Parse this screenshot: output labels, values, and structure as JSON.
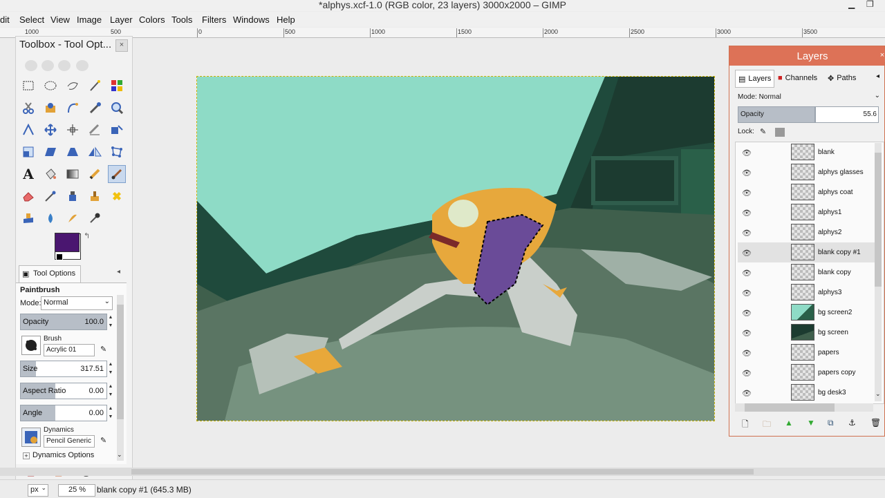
{
  "window": {
    "title": "*alphys.xcf-1.0 (RGB color, 23 layers) 3000x2000 – GIMP"
  },
  "menu": [
    "dit",
    "Select",
    "View",
    "Image",
    "Layer",
    "Colors",
    "Tools",
    "Filters",
    "Windows",
    "Help"
  ],
  "ruler": {
    "labels": [
      "1000",
      "500",
      "0",
      "500",
      "1000",
      "1500",
      "2000",
      "2500",
      "3000",
      "3500"
    ]
  },
  "toolbox": {
    "title": "Toolbox - Tool Opt...",
    "colors": {
      "foreground": "#4a1670",
      "background": "#ffffff"
    },
    "tools": [
      [
        "rect-select-icon",
        "ellipse-select-icon",
        "free-select-icon",
        "fuzzy-select-icon",
        "select-by-color-icon"
      ],
      [
        "scissors-icon",
        "foreground-select-icon",
        "paths-icon",
        "color-picker-icon",
        "zoom-icon"
      ],
      [
        "measure-icon",
        "move-icon",
        "align-icon",
        "crop-icon",
        "rotate-icon"
      ],
      [
        "scale-icon",
        "shear-icon",
        "perspective-icon",
        "flip-icon",
        "cage-icon"
      ],
      [
        "text-icon",
        "bucket-fill-icon",
        "blend-icon",
        "pencil-icon",
        "paintbrush-icon"
      ],
      [
        "eraser-icon",
        "airbrush-icon",
        "ink-icon",
        "clone-icon",
        "heal-icon"
      ],
      [
        "perspective-clone-icon",
        "blur-icon",
        "smudge-icon",
        "dodge-burn-icon"
      ]
    ],
    "active_tool": "paintbrush-icon"
  },
  "tool_options": {
    "tab_label": "Tool Options",
    "tool_name": "Paintbrush",
    "mode_label": "Mode:",
    "mode_value": "Normal",
    "opacity_label": "Opacity",
    "opacity_value": "100.0",
    "brush_label": "Brush",
    "brush_value": "Acrylic 01",
    "size_label": "Size",
    "size_value": "317.51",
    "aspect_label": "Aspect Ratio",
    "aspect_value": "0.00",
    "angle_label": "Angle",
    "angle_value": "0.00",
    "dynamics_label": "Dynamics",
    "dynamics_value": "Pencil Generic",
    "dynamics_options_label": "Dynamics Options"
  },
  "layers_panel": {
    "title": "Layers",
    "tabs": [
      "Layers",
      "Channels",
      "Paths"
    ],
    "mode_label": "Mode: Normal",
    "opacity_label": "Opacity",
    "opacity_value": "55.6",
    "lock_label": "Lock:",
    "layers": [
      {
        "name": "blank"
      },
      {
        "name": "alphys glasses"
      },
      {
        "name": "alphys coat"
      },
      {
        "name": "alphys1"
      },
      {
        "name": "alphys2"
      },
      {
        "name": "blank copy #1",
        "selected": true
      },
      {
        "name": "blank copy"
      },
      {
        "name": "alphys3"
      },
      {
        "name": "bg screen2"
      },
      {
        "name": "bg screen"
      },
      {
        "name": "papers"
      },
      {
        "name": "papers copy"
      },
      {
        "name": "bg desk3"
      }
    ]
  },
  "status": {
    "unit": "px",
    "zoom": "25 %",
    "message": "blank copy #1 (645.3 MB)"
  }
}
